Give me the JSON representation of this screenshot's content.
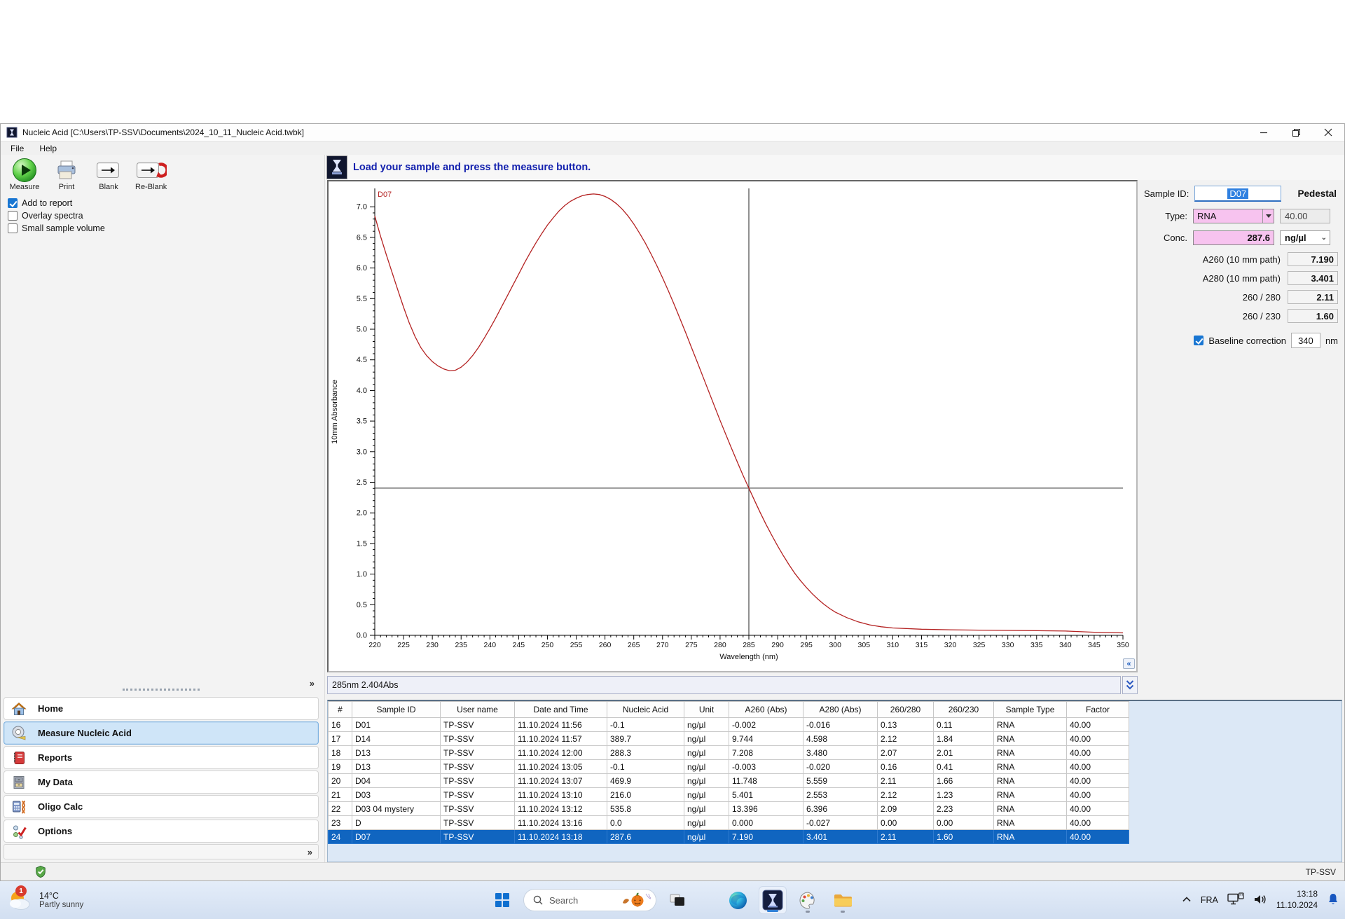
{
  "window": {
    "title": "Nucleic Acid  [C:\\Users\\TP-SSV\\Documents\\2024_10_11_Nucleic Acid.twbk]",
    "menu": [
      "File",
      "Help"
    ]
  },
  "toolbar": {
    "buttons": [
      {
        "label": "Measure"
      },
      {
        "label": "Print"
      },
      {
        "label": "Blank"
      },
      {
        "label": "Re-Blank"
      }
    ]
  },
  "options": [
    {
      "label": "Add to report",
      "checked": true
    },
    {
      "label": "Overlay spectra",
      "checked": false
    },
    {
      "label": "Small sample volume",
      "checked": false
    }
  ],
  "message": "Load your sample and press the measure button.",
  "chart_data": {
    "type": "line",
    "xlabel": "Wavelength (nm)",
    "ylabel": "10mm Absorbance",
    "xlim": [
      220,
      350
    ],
    "ylim": [
      0,
      7.3
    ],
    "x_ticks": [
      220,
      225,
      230,
      235,
      240,
      245,
      250,
      255,
      260,
      265,
      270,
      275,
      280,
      285,
      290,
      295,
      300,
      305,
      310,
      315,
      320,
      325,
      330,
      335,
      340,
      345,
      350
    ],
    "y_ticks": [
      0.0,
      0.5,
      1.0,
      1.5,
      2.0,
      2.5,
      3.0,
      3.5,
      4.0,
      4.5,
      5.0,
      5.5,
      6.0,
      6.5,
      7.0
    ],
    "grid": false,
    "crosshair": {
      "x": 285,
      "y": 2.404
    },
    "series": [
      {
        "name": "D07",
        "color": "#b42222",
        "x": [
          220,
          221,
          222,
          223,
          224,
          225,
          226,
          227,
          228,
          229,
          230,
          231,
          232,
          233,
          234,
          235,
          236,
          237,
          238,
          239,
          240,
          241,
          242,
          243,
          244,
          245,
          246,
          247,
          248,
          249,
          250,
          251,
          252,
          253,
          254,
          255,
          256,
          257,
          258,
          259,
          260,
          261,
          262,
          263,
          264,
          265,
          266,
          267,
          268,
          269,
          270,
          271,
          272,
          273,
          274,
          275,
          276,
          277,
          278,
          279,
          280,
          281,
          282,
          283,
          284,
          285,
          286,
          287,
          288,
          289,
          290,
          291,
          292,
          293,
          294,
          295,
          296,
          297,
          298,
          299,
          300,
          302,
          304,
          306,
          308,
          310,
          315,
          320,
          325,
          330,
          335,
          340,
          345,
          350
        ],
        "y": [
          6.85,
          6.52,
          6.22,
          5.93,
          5.64,
          5.36,
          5.1,
          4.88,
          4.7,
          4.57,
          4.47,
          4.4,
          4.35,
          4.32,
          4.33,
          4.38,
          4.46,
          4.57,
          4.7,
          4.85,
          5.01,
          5.18,
          5.36,
          5.54,
          5.72,
          5.9,
          6.08,
          6.25,
          6.41,
          6.56,
          6.7,
          6.82,
          6.93,
          7.02,
          7.09,
          7.14,
          7.18,
          7.2,
          7.21,
          7.2,
          7.17,
          7.12,
          7.05,
          6.96,
          6.85,
          6.72,
          6.57,
          6.41,
          6.23,
          6.04,
          5.84,
          5.63,
          5.41,
          5.18,
          4.95,
          4.71,
          4.47,
          4.23,
          3.99,
          3.75,
          3.51,
          3.28,
          3.05,
          2.83,
          2.61,
          2.404,
          2.2,
          2.0,
          1.81,
          1.63,
          1.46,
          1.3,
          1.15,
          1.01,
          0.89,
          0.78,
          0.68,
          0.59,
          0.51,
          0.44,
          0.38,
          0.29,
          0.22,
          0.17,
          0.14,
          0.12,
          0.1,
          0.09,
          0.085,
          0.08,
          0.075,
          0.07,
          0.05,
          0.04
        ]
      }
    ]
  },
  "status_readout": "285nm 2.404Abs",
  "sample_panel": {
    "sample_id_label": "Sample ID:",
    "sample_id_value": "D07",
    "mode": "Pedestal",
    "type_label": "Type:",
    "type_value": "RNA",
    "factor_value": "40.00",
    "conc_label": "Conc.",
    "conc_value": "287.6",
    "conc_unit": "ng/µl",
    "metrics": [
      {
        "label": "A260 (10 mm path)",
        "value": "7.190"
      },
      {
        "label": "A280 (10 mm path)",
        "value": "3.401"
      },
      {
        "label": "260 / 280",
        "value": "2.11"
      },
      {
        "label": "260 / 230",
        "value": "1.60"
      }
    ],
    "baseline": {
      "label": "Baseline correction",
      "checked": true,
      "value": "340",
      "unit": "nm"
    }
  },
  "nav": {
    "selected_index": 1,
    "items": [
      {
        "label": "Home"
      },
      {
        "label": "Measure Nucleic Acid"
      },
      {
        "label": "Reports"
      },
      {
        "label": "My Data"
      },
      {
        "label": "Oligo Calc"
      },
      {
        "label": "Options"
      }
    ],
    "expander": "»"
  },
  "table": {
    "columns": [
      "#",
      "Sample ID",
      "User name",
      "Date and Time",
      "Nucleic Acid",
      "Unit",
      "A260 (Abs)",
      "A280 (Abs)",
      "260/280",
      "260/230",
      "Sample Type",
      "Factor"
    ],
    "selected_row_index": 8,
    "rows": [
      [
        "16",
        "D01",
        "TP-SSV",
        "11.10.2024 11:56",
        "-0.1",
        "ng/µl",
        "-0.002",
        "-0.016",
        "0.13",
        "0.11",
        "RNA",
        "40.00"
      ],
      [
        "17",
        "D14",
        "TP-SSV",
        "11.10.2024 11:57",
        "389.7",
        "ng/µl",
        "9.744",
        "4.598",
        "2.12",
        "1.84",
        "RNA",
        "40.00"
      ],
      [
        "18",
        "D13",
        "TP-SSV",
        "11.10.2024 12:00",
        "288.3",
        "ng/µl",
        "7.208",
        "3.480",
        "2.07",
        "2.01",
        "RNA",
        "40.00"
      ],
      [
        "19",
        "D13",
        "TP-SSV",
        "11.10.2024 13:05",
        "-0.1",
        "ng/µl",
        "-0.003",
        "-0.020",
        "0.16",
        "0.41",
        "RNA",
        "40.00"
      ],
      [
        "20",
        "D04",
        "TP-SSV",
        "11.10.2024 13:07",
        "469.9",
        "ng/µl",
        "11.748",
        "5.559",
        "2.11",
        "1.66",
        "RNA",
        "40.00"
      ],
      [
        "21",
        "D03",
        "TP-SSV",
        "11.10.2024 13:10",
        "216.0",
        "ng/µl",
        "5.401",
        "2.553",
        "2.12",
        "1.23",
        "RNA",
        "40.00"
      ],
      [
        "22",
        "D03 04 mystery",
        "TP-SSV",
        "11.10.2024 13:12",
        "535.8",
        "ng/µl",
        "13.396",
        "6.396",
        "2.09",
        "2.23",
        "RNA",
        "40.00"
      ],
      [
        "23",
        "D",
        "TP-SSV",
        "11.10.2024 13:16",
        "0.0",
        "ng/µl",
        "0.000",
        "-0.027",
        "0.00",
        "0.00",
        "RNA",
        "40.00"
      ],
      [
        "24",
        "D07",
        "TP-SSV",
        "11.10.2024 13:18",
        "287.6",
        "ng/µl",
        "7.190",
        "3.401",
        "2.11",
        "1.60",
        "RNA",
        "40.00"
      ]
    ]
  },
  "app_statusbar": {
    "user": "TP-SSV"
  },
  "taskbar": {
    "weather": {
      "badge": "1",
      "temp": "14°C",
      "condition": "Partly sunny"
    },
    "search_placeholder": "Search",
    "tray": {
      "language": "FRA",
      "time": "13:18",
      "date": "11.10.2024"
    }
  }
}
